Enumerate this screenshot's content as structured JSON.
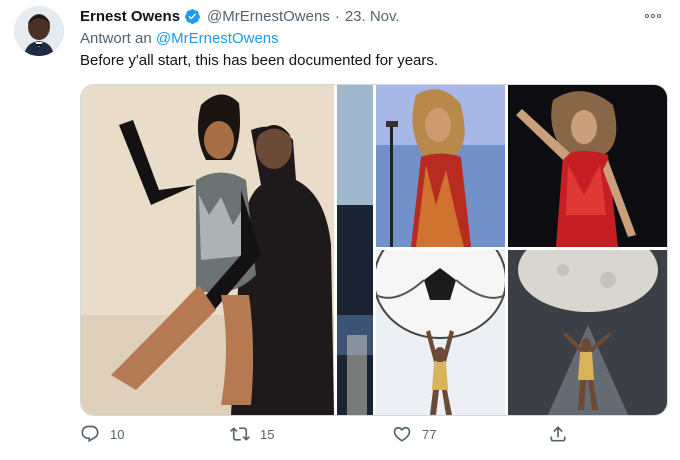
{
  "tweet": {
    "author_name": "Ernest Owens",
    "handle": "@MrErnestOwens",
    "separator": "·",
    "date": "23. Nov.",
    "reply_prefix": "Antwort an",
    "reply_to": "@MrErnestOwens",
    "text": "Before y'all start, this has been documented for years.",
    "verified": true
  },
  "actions": {
    "reply_count": "10",
    "retweet_count": "15",
    "like_count": "77"
  },
  "icons": {
    "avatar": "avatar",
    "verified": "verified-badge-icon",
    "more": "more-options-icon",
    "reply": "reply-icon",
    "retweet": "retweet-icon",
    "like": "like-icon",
    "share": "share-icon"
  },
  "colors": {
    "accent": "#1d9bf0",
    "muted": "#536471",
    "text": "#0f1419"
  }
}
